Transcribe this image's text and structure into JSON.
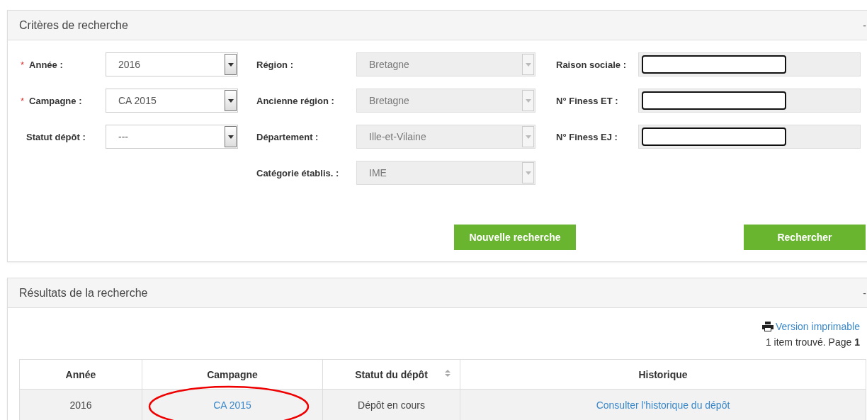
{
  "criteria_panel": {
    "title": "Critères de recherche",
    "collapse": "-",
    "columns": [
      [
        {
          "required_mark": "*",
          "label": "Année :",
          "kind": "select",
          "value": "2016",
          "disabled": false
        },
        {
          "required_mark": "*",
          "label": "Campagne :",
          "kind": "select",
          "value": "CA 2015",
          "disabled": false
        },
        {
          "label": "Statut dépôt :",
          "kind": "select",
          "value": "---",
          "disabled": false
        }
      ],
      [
        {
          "label": "Région :",
          "kind": "select",
          "value": "Bretagne",
          "disabled": true
        },
        {
          "label": "Ancienne région :",
          "kind": "select",
          "value": "Bretagne",
          "disabled": true
        },
        {
          "label": "Département :",
          "kind": "select",
          "value": "Ille-et-Vilaine",
          "disabled": true
        },
        {
          "label": "Catégorie établis. :",
          "kind": "select",
          "value": "IME",
          "disabled": true
        }
      ],
      [
        {
          "label": "Raison sociale :",
          "kind": "text",
          "disabled": true
        },
        {
          "label": "N° Finess ET :",
          "kind": "text",
          "disabled": true
        },
        {
          "label": "N° Finess EJ :",
          "kind": "text",
          "disabled": true
        }
      ]
    ],
    "buttons": [
      "Nouvelle recherche",
      "Rechercher"
    ]
  },
  "results_panel": {
    "title": "Résultats de la recherche",
    "collapse": "-",
    "print_link": "Version imprimable",
    "count_text": "1 item trouvé. Page **1**",
    "table": {
      "columns": [
        {
          "label": "Année",
          "sortable": false
        },
        {
          "label": "Campagne",
          "sortable": false
        },
        {
          "label": "Statut du dépôt",
          "sortable": true
        },
        {
          "label": "Historique",
          "sortable": false
        }
      ],
      "rows": [
        [
          {
            "text": "2016",
            "kind": "text"
          },
          {
            "text": "CA 2015",
            "kind": "link",
            "circled": true
          },
          {
            "text": "Dépôt en cours",
            "kind": "text"
          },
          {
            "text": "Consulter l'historique du dépôt",
            "kind": "link"
          }
        ]
      ]
    }
  }
}
